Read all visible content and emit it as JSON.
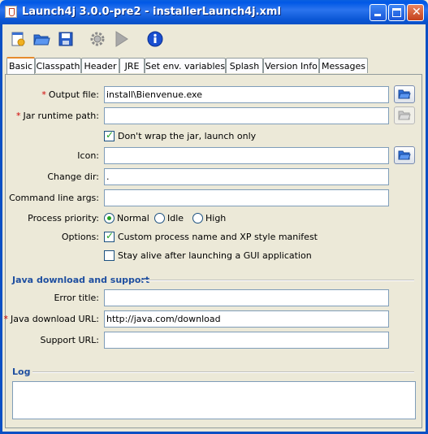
{
  "window": {
    "title": "Launch4j 3.0.0-pre2 - installerLaunch4j.xml",
    "controls": [
      "minimize",
      "maximize",
      "close"
    ]
  },
  "toolbar": {
    "icons": [
      "new-file-icon",
      "open-folder-icon",
      "save-icon",
      "build-gear-icon",
      "run-icon",
      "info-icon"
    ]
  },
  "tabs": [
    {
      "label": "Basic",
      "active": true
    },
    {
      "label": "Classpath"
    },
    {
      "label": "Header"
    },
    {
      "label": "JRE"
    },
    {
      "label": "Set env. variables"
    },
    {
      "label": "Splash"
    },
    {
      "label": "Version Info"
    },
    {
      "label": "Messages"
    }
  ],
  "basic": {
    "output_file": {
      "label": "Output file:",
      "required": "*",
      "value": "install\\Bienvenue.exe"
    },
    "jar_runtime_path": {
      "label": "Jar runtime path:",
      "required": "*",
      "value": ""
    },
    "dont_wrap": {
      "label": "Don't wrap the jar, launch only",
      "checked": true
    },
    "icon": {
      "label": "Icon:",
      "value": ""
    },
    "change_dir": {
      "label": "Change dir:",
      "value": "."
    },
    "cmd_args": {
      "label": "Command line args:",
      "value": ""
    },
    "priority": {
      "label": "Process priority:",
      "options": [
        "Normal",
        "Idle",
        "High"
      ],
      "selected": "Normal"
    },
    "options": {
      "label": "Options:",
      "custom_process": {
        "label": "Custom process name and XP style manifest",
        "checked": true
      },
      "stay_alive": {
        "label": "Stay alive after launching a GUI application",
        "checked": false
      }
    }
  },
  "java_download": {
    "section_title": "Java download and support",
    "error_title": {
      "label": "Error title:",
      "value": ""
    },
    "download_url": {
      "label": "Java download URL:",
      "required": "*",
      "value": "http://java.com/download"
    },
    "support_url": {
      "label": "Support URL:",
      "value": ""
    }
  },
  "log": {
    "section_title": "Log",
    "content": ""
  }
}
